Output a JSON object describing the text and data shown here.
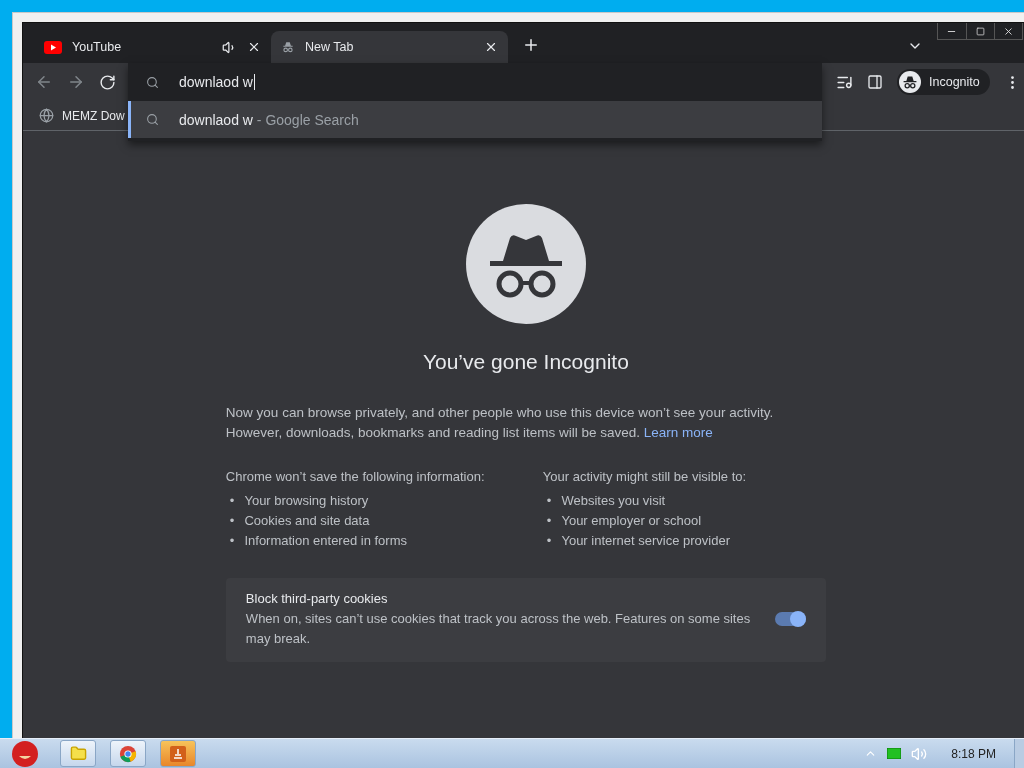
{
  "tabs": [
    {
      "title": "YouTube",
      "selected": false,
      "audio": true,
      "kind": "video"
    },
    {
      "title": "New Tab",
      "selected": true,
      "audio": false,
      "kind": "incognito"
    }
  ],
  "omnibox": {
    "value": "downlaod w",
    "suggestions": [
      {
        "text": "downlaod w",
        "source": " - Google Search",
        "selected": true
      }
    ]
  },
  "profile": {
    "label": "Incognito"
  },
  "bookmarks": [
    {
      "title": "MEMZ Dow"
    }
  ],
  "incognito_page": {
    "title": "You’ve gone Incognito",
    "intro": "Now you can browse privately, and other people who use this device won’t see your activity. However, downloads, bookmarks and reading list items will be saved.",
    "learn_more": "Learn more",
    "columns": [
      {
        "heading": "Chrome won’t save the following information:",
        "marker": "•",
        "items": [
          "Your browsing history",
          "Cookies and site data",
          "Information entered in forms"
        ]
      },
      {
        "heading": "Your activity might still be visible to:",
        "marker": "•",
        "items": [
          "Websites you visit",
          "Your employer or school",
          "Your internet service provider"
        ]
      }
    ],
    "cookies_card": {
      "title": "Block third-party cookies",
      "description": "When on, sites can’t use cookies that track you across the web. Features on some sites may break.",
      "on": true
    }
  },
  "taskbar": {
    "clock": "8:18 PM"
  }
}
